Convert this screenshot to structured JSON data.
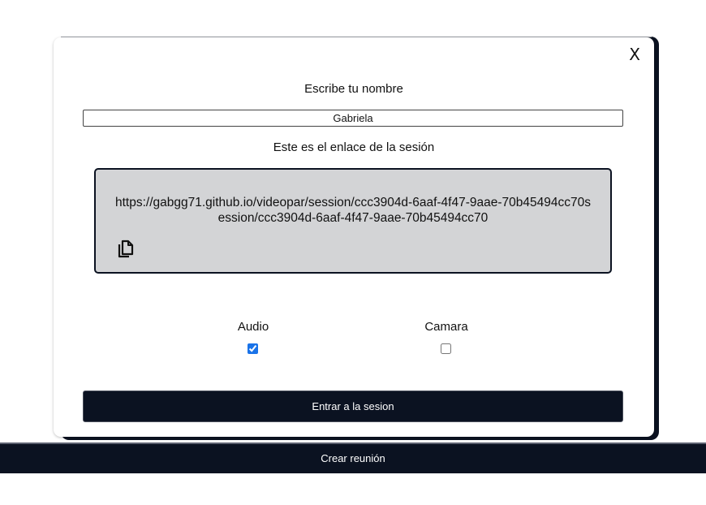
{
  "background": {
    "create_meeting_label": "Crear reunión"
  },
  "modal": {
    "close_label": "X",
    "name_prompt": "Escribe tu nombre",
    "name_value": "Gabriela",
    "link_prompt": "Este es el enlace de la sesión",
    "session_link": "https://gabgg71.github.io/videopar/session/ccc3904d-6aaf-4f47-9aae-70b45494cc70session/ccc3904d-6aaf-4f47-9aae-70b45494cc70",
    "copy_icon": "copy-icon",
    "audio_label": "Audio",
    "audio_checked": true,
    "camera_label": "Camara",
    "camera_checked": false,
    "enter_label": "Entrar a la sesion"
  },
  "colors": {
    "dark": "#0b1221",
    "link_box_bg": "#d3d4d6",
    "checkbox_accent": "#1a73e8"
  }
}
